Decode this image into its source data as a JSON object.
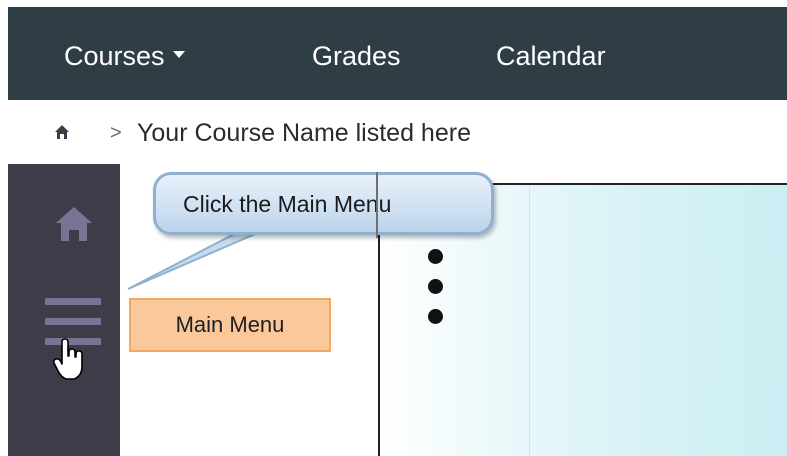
{
  "navbar": {
    "items": [
      {
        "label": "Courses",
        "has_dropdown": true
      },
      {
        "label": "Grades"
      },
      {
        "label": "Calendar"
      }
    ],
    "background": "#2f3d45"
  },
  "breadcrumb": {
    "home_icon": "home-icon",
    "separator": ">",
    "current": "Your Course Name listed here"
  },
  "sidebar": {
    "background": "#3f3c4a",
    "items": [
      {
        "icon": "home-icon"
      },
      {
        "icon": "hamburger-menu-icon"
      }
    ]
  },
  "annotations": {
    "callout_text": "Click the Main Menu",
    "label_text": "Main Menu",
    "label_color": "#fbc89b",
    "callout_color": "#cfe0f2"
  },
  "content": {
    "kebab_icon": "vertical-dots-menu-icon"
  }
}
